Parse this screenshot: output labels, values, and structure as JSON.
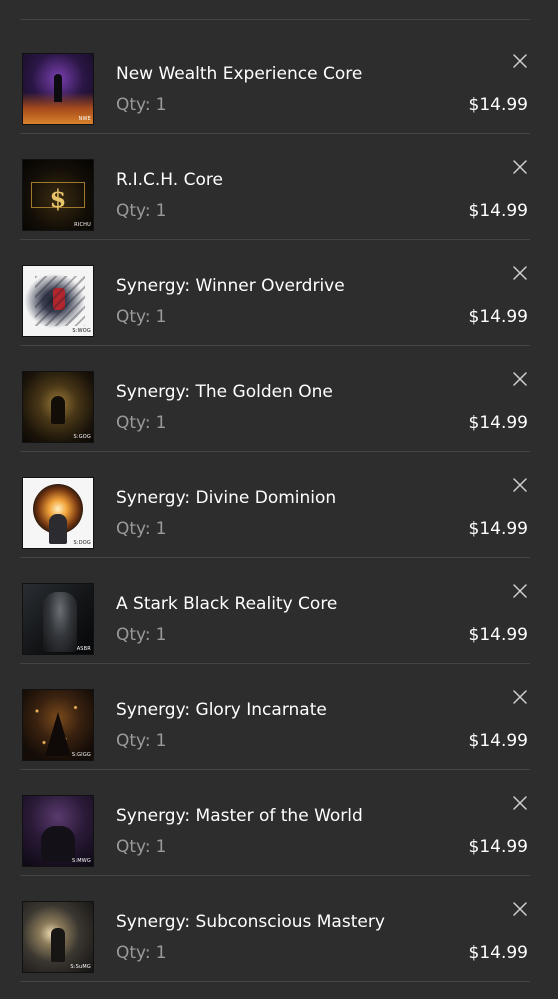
{
  "currency": "$",
  "colors": {
    "background": "#2d2d2d",
    "divider": "#444444",
    "muted_text": "#9a9a9a"
  },
  "qty_label": "Qty:",
  "remove_icon": "close-icon",
  "items": [
    {
      "title": "New Wealth Experience Core",
      "qty": "1",
      "price": "$14.99",
      "thumb_code": "NWE"
    },
    {
      "title": "R.I.C.H. Core",
      "qty": "1",
      "price": "$14.99",
      "thumb_code": "RICHU"
    },
    {
      "title": "Synergy: Winner Overdrive",
      "qty": "1",
      "price": "$14.99",
      "thumb_code": "S:WOG"
    },
    {
      "title": "Synergy: The Golden One",
      "qty": "1",
      "price": "$14.99",
      "thumb_code": "S:GOG"
    },
    {
      "title": "Synergy: Divine Dominion",
      "qty": "1",
      "price": "$14.99",
      "thumb_code": "S:DOG"
    },
    {
      "title": "A Stark Black Reality Core",
      "qty": "1",
      "price": "$14.99",
      "thumb_code": "ASBR"
    },
    {
      "title": "Synergy: Glory Incarnate",
      "qty": "1",
      "price": "$14.99",
      "thumb_code": "S:GIGG"
    },
    {
      "title": "Synergy: Master of the World",
      "qty": "1",
      "price": "$14.99",
      "thumb_code": "S:MWG"
    },
    {
      "title": "Synergy: Subconscious Mastery",
      "qty": "1",
      "price": "$14.99",
      "thumb_code": "S:SuMG"
    }
  ]
}
